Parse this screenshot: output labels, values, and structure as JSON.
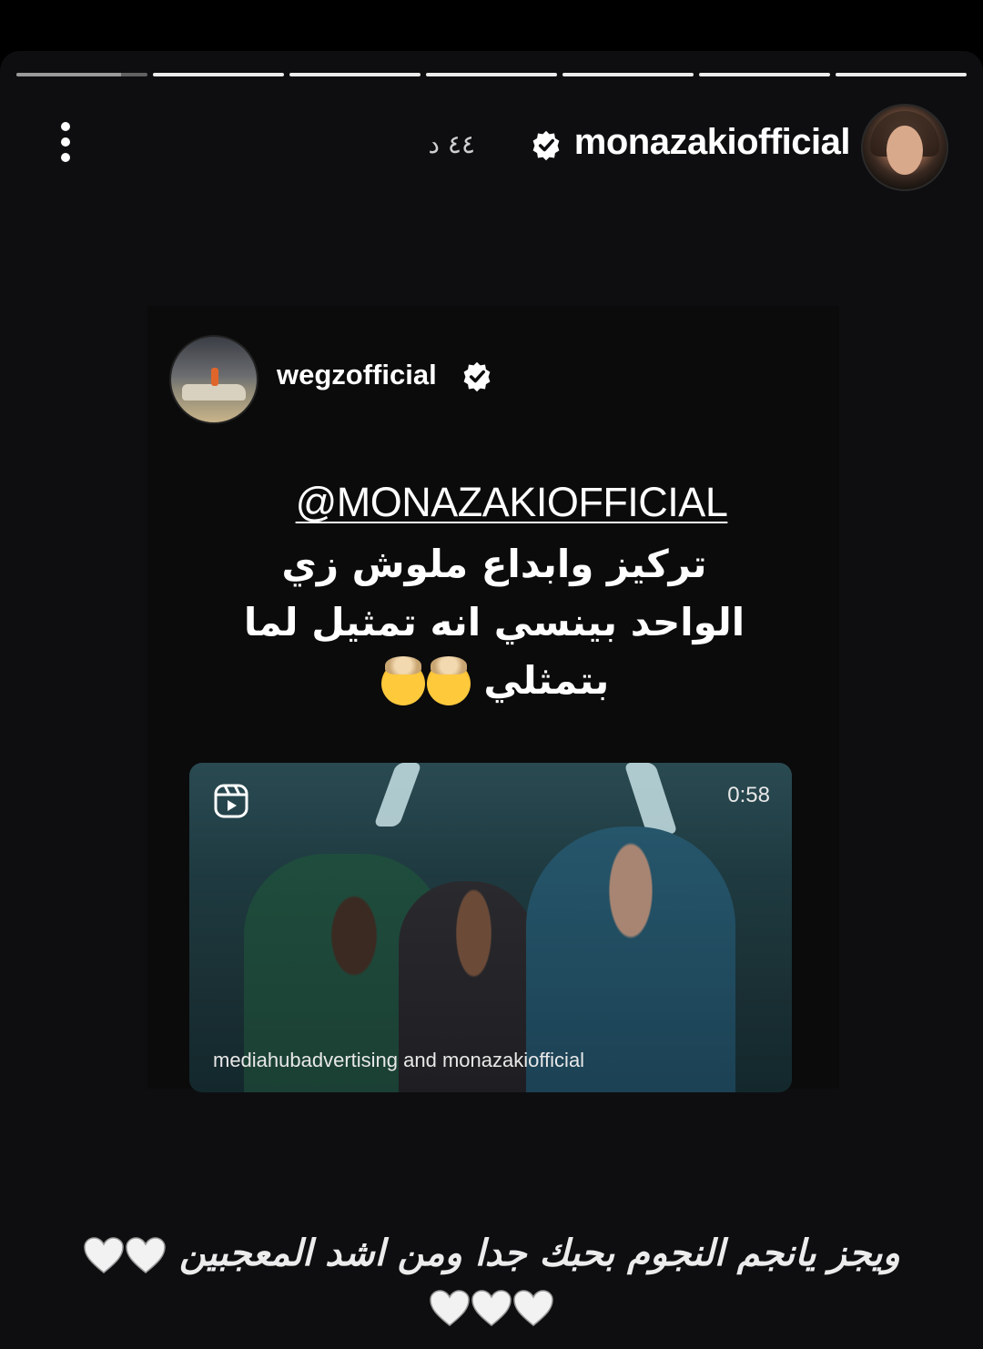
{
  "story": {
    "progress_segments": 7,
    "active_segment_index": 0,
    "active_segment_progress": 0.8
  },
  "header": {
    "username": "monazakiofficial",
    "time_ago": "٤٤ د"
  },
  "shared_post": {
    "author": "wegzofficial",
    "mention": "@MONAZAKIOFFICIAL",
    "lines": [
      "تركيز وابداع ملوش زي",
      "الواحد بينسي انه تمثيل لما",
      "بتمثلي"
    ]
  },
  "video": {
    "duration": "0:58",
    "credit": "mediahubadvertising and monazakiofficial"
  },
  "caption": {
    "line1": "ويجز يانجم النجوم بحبك جدا ومن اشد المعجبين"
  },
  "colors": {
    "background": "#0e0e10",
    "text": "#ffffff",
    "heart": "#f2f2f2"
  },
  "icons": [
    "verified-badge-icon",
    "more-options-icon",
    "reels-icon",
    "white-heart-icon",
    "exploding-head-emoji"
  ]
}
